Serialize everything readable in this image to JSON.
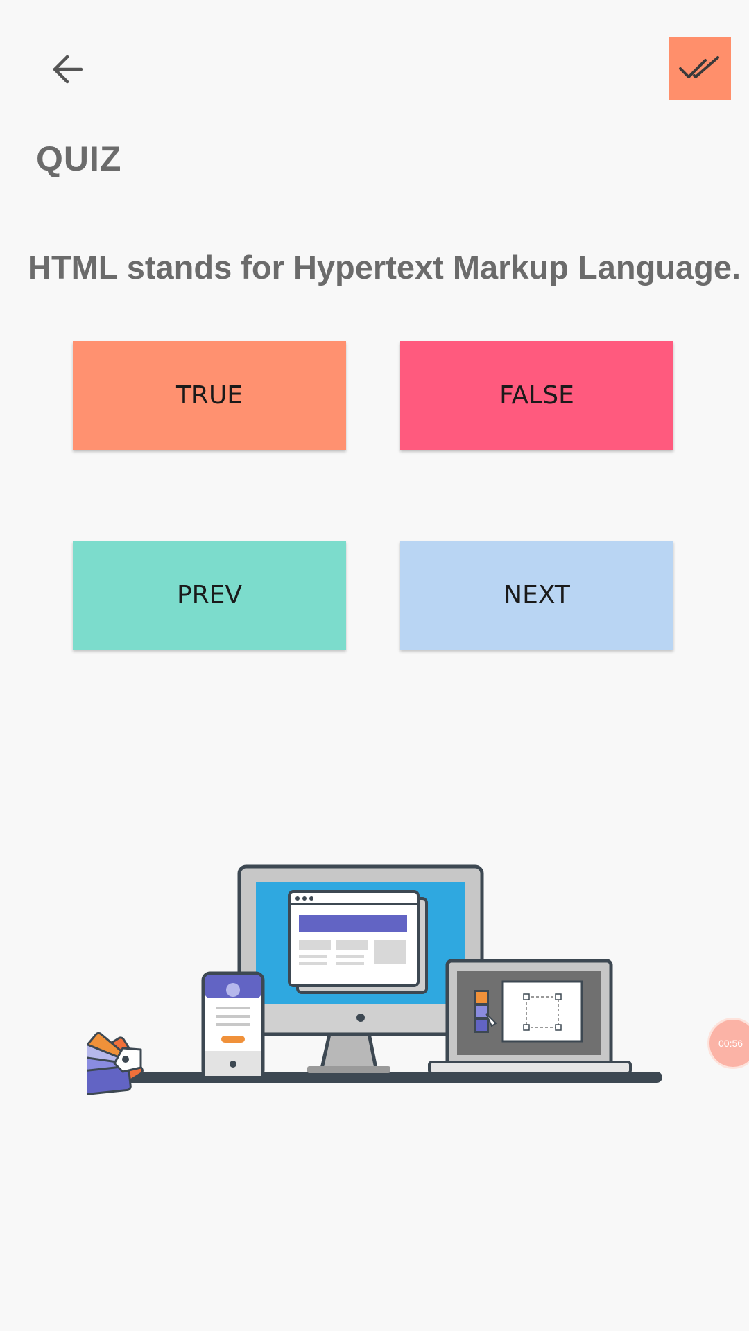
{
  "header": {
    "back_icon": "arrow-left-icon",
    "done_icon": "double-check-icon",
    "accent_color": "#ff8f6b"
  },
  "page": {
    "title": "QUIZ",
    "question": "HTML stands for Hypertext Markup Language."
  },
  "answers": {
    "true_label": "TRUE",
    "false_label": "FALSE"
  },
  "navigation": {
    "prev_label": "PREV",
    "next_label": "NEXT"
  },
  "button_colors": {
    "true": "#ff9170",
    "false": "#ff5a7e",
    "prev": "#7cdccc",
    "next": "#b9d5f3"
  },
  "timer": {
    "value": "00:56"
  }
}
